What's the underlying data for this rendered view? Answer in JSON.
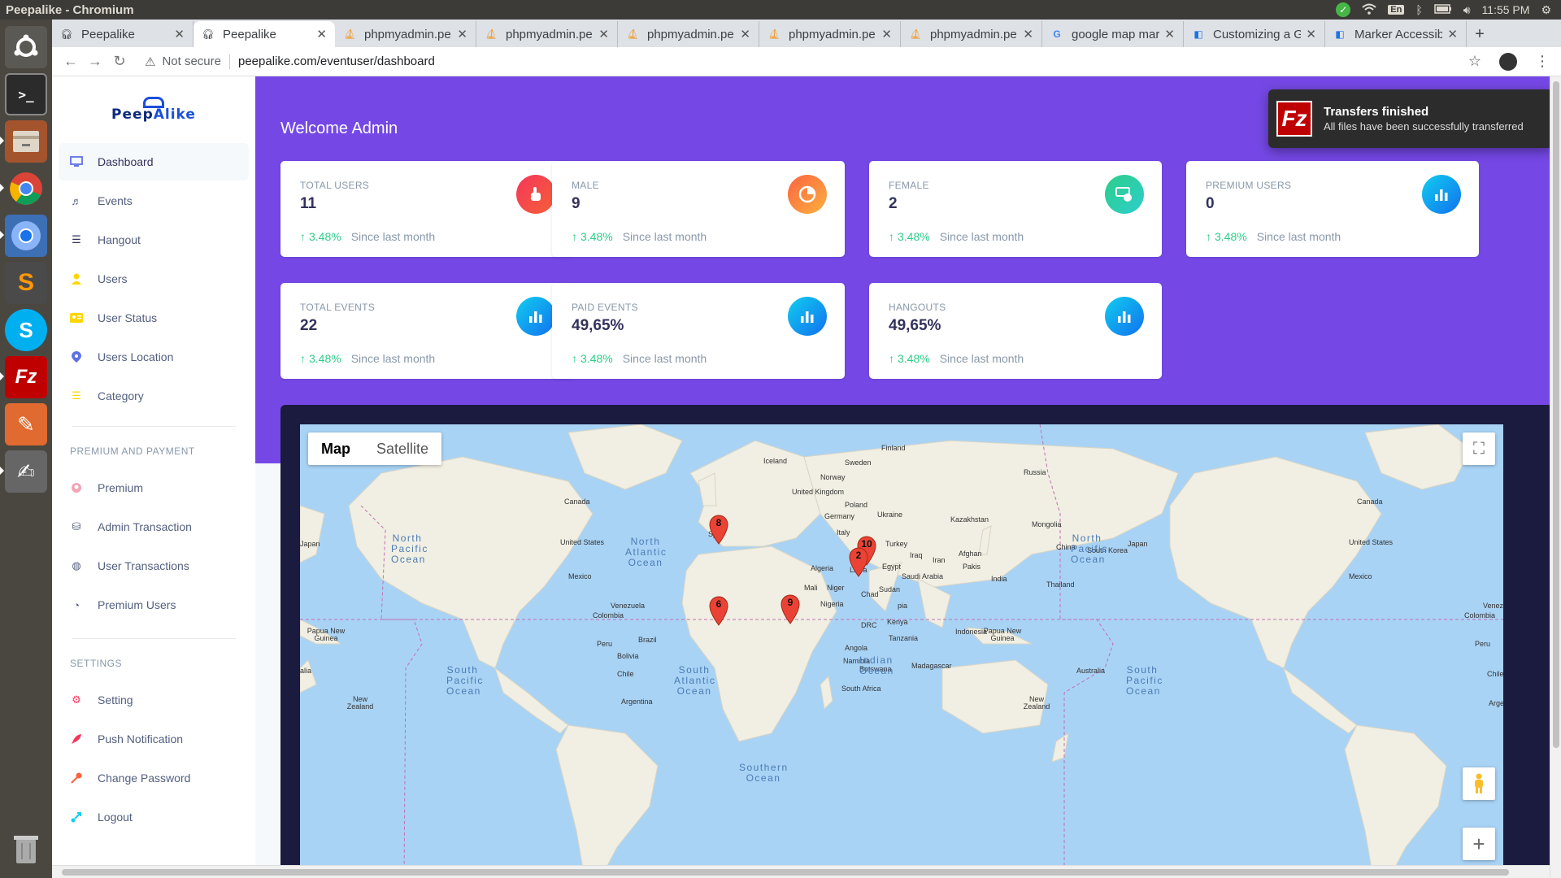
{
  "os": {
    "window_title": "Peepalike - Chromium",
    "lang": "En",
    "time": "11:55 PM"
  },
  "browser": {
    "tabs": [
      {
        "label": "Peepalike",
        "icon": "peepalike-icon"
      },
      {
        "label": "Peepalike",
        "icon": "peepalike-icon",
        "active": true
      },
      {
        "label": "phpmyadmin.pe",
        "icon": "phpmyadmin-icon"
      },
      {
        "label": "phpmyadmin.pe",
        "icon": "phpmyadmin-icon"
      },
      {
        "label": "phpmyadmin.pe",
        "icon": "phpmyadmin-icon"
      },
      {
        "label": "phpmyadmin.pe",
        "icon": "phpmyadmin-icon"
      },
      {
        "label": "phpmyadmin.pe",
        "icon": "phpmyadmin-icon"
      },
      {
        "label": "google map mar",
        "icon": "google-icon"
      },
      {
        "label": "Customizing a G",
        "icon": "dev-icon"
      },
      {
        "label": "Marker Accessib",
        "icon": "dev-icon"
      }
    ],
    "security": "Not secure",
    "url": "peepalike.com/eventuser/dashboard"
  },
  "sidebar": {
    "logo_text_a": "Peep",
    "logo_text_b": "Alike",
    "items": [
      {
        "label": "Dashboard",
        "icon": "monitor-icon",
        "color": "#5e72e4"
      },
      {
        "label": "Events",
        "icon": "events-icon",
        "color": "#525f7f"
      },
      {
        "label": "Hangout",
        "icon": "list-icon",
        "color": "#32325d"
      },
      {
        "label": "Users",
        "icon": "user-icon",
        "color": "#ffd600"
      },
      {
        "label": "User Status",
        "icon": "id-card-icon",
        "color": "#ffd600"
      },
      {
        "label": "Users Location",
        "icon": "location-pin-icon",
        "color": "#5e72e4"
      },
      {
        "label": "Category",
        "icon": "menu-lines-icon",
        "color": "#ffd600"
      }
    ],
    "premium_heading": "PREMIUM AND PAYMENT",
    "premium_items": [
      {
        "label": "Premium",
        "icon": "premium-icon",
        "color": "#f3a4b5"
      },
      {
        "label": "Admin Transaction",
        "icon": "transaction-icon",
        "color": "#525f7f"
      },
      {
        "label": "User Transactions",
        "icon": "globe-icon",
        "color": "#525f7f"
      },
      {
        "label": "Premium Users",
        "icon": "pie-icon",
        "color": "#525f7f"
      }
    ],
    "settings_heading": "SETTINGS",
    "settings_items": [
      {
        "label": "Setting",
        "icon": "settings-icon",
        "color": "#f5365c"
      },
      {
        "label": "Push Notification",
        "icon": "rocket-icon",
        "color": "#f5365c"
      },
      {
        "label": "Change Password",
        "icon": "key-icon",
        "color": "#fb6340"
      },
      {
        "label": "Logout",
        "icon": "logout-icon",
        "color": "#11cdef"
      }
    ]
  },
  "dashboard": {
    "welcome": "Welcome Admin",
    "cards": [
      {
        "label": "TOTAL USERS",
        "value": "11",
        "pct": "3.48%",
        "since": "Since last month",
        "icon": "hand-pointer-icon"
      },
      {
        "label": "MALE",
        "value": "9",
        "pct": "3.48%",
        "since": "Since last month",
        "icon": "pie-chart-icon"
      },
      {
        "label": "FEMALE",
        "value": "2",
        "pct": "3.48%",
        "since": "Since last month",
        "icon": "money-icon"
      },
      {
        "label": "PREMIUM USERS",
        "value": "0",
        "pct": "3.48%",
        "since": "Since last month",
        "icon": "bar-chart-icon"
      },
      {
        "label": "TOTAL EVENTS",
        "value": "22",
        "pct": "3.48%",
        "since": "Since last month",
        "icon": "bar-chart-icon"
      },
      {
        "label": "PAID EVENTS",
        "value": "49,65%",
        "pct": "3.48%",
        "since": "Since last month",
        "icon": "bar-chart-icon"
      },
      {
        "label": "HANGOUTS",
        "value": "49,65%",
        "pct": "3.48%",
        "since": "Since last month",
        "icon": "bar-chart-icon"
      }
    ]
  },
  "map": {
    "type_map": "Map",
    "type_satellite": "Satellite",
    "country_labels": [
      "Finland",
      "Iceland",
      "Sweden",
      "Norway",
      "Russia",
      "United Kingdom",
      "Poland",
      "Ukraine",
      "Germany",
      "Kazakhstan",
      "Mongolia",
      "Italy",
      "Canada",
      "Canada",
      "United States",
      "United States",
      "Japan",
      "Japan",
      "Turkey",
      "China",
      "South Korea",
      "Iraq",
      "Iran",
      "Afghan",
      "Pakis",
      "India",
      "Mexico",
      "Mexico",
      "Algeria",
      "Libya",
      "Egypt",
      "Saudi Arabia",
      "Thailand",
      "Mali",
      "Niger",
      "Chad",
      "Sudan",
      "Nigeria",
      "Venezuela",
      "Colombia",
      "Venezu",
      "Colombia",
      "Papua New Guinea",
      "Papua New Guinea",
      "DRC",
      "Kenya",
      "Tanzania",
      "Indonesia",
      "Peru",
      "Brazil",
      "Peru",
      "Bolivia",
      "Angola",
      "Namibia",
      "Botswana",
      "Madagascar",
      "Chile",
      "Chile",
      "South Africa",
      "Australia",
      "Argentina",
      "New Zealand",
      "New Zealand",
      "Arge",
      "alia",
      "Sp",
      "pia"
    ],
    "ocean_labels": [
      "North Pacific Ocean",
      "North Atlantic Ocean",
      "North Pacific Ocean",
      "South Pacific Ocean",
      "South Atlantic Ocean",
      "Indian Ocean",
      "South Pacific Ocean",
      "Southern Ocean"
    ],
    "markers": [
      "8",
      "6",
      "9",
      "10",
      "2"
    ]
  },
  "toast": {
    "title": "Transfers finished",
    "message": "All files have been successfully transferred"
  }
}
